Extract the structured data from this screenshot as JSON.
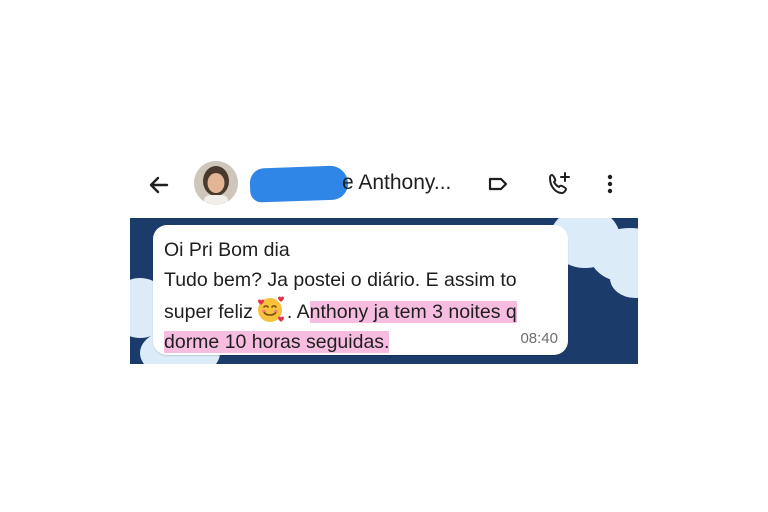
{
  "header": {
    "contact_name": "e Anthony...",
    "back_icon": "arrow-left-icon",
    "label_icon": "label-tag-icon",
    "call_icon": "add-call-icon",
    "menu_icon": "more-vertical-icon"
  },
  "message": {
    "line1": "Oi Pri Bom dia",
    "line2": "Tudo bem? Ja postei o diário. E assim to",
    "line3_before": "super feliz",
    "emoji": "smiling-face-with-hearts",
    "line3_plain": ". A",
    "line3_highlight": "nthony ja tem 3 noites q",
    "line4_highlight": "dorme 10 horas seguidas.",
    "time": "08:40"
  },
  "colors": {
    "chat_background": "#1b3b6a",
    "highlight": "#f7bde0",
    "redaction": "#2f86e6"
  }
}
